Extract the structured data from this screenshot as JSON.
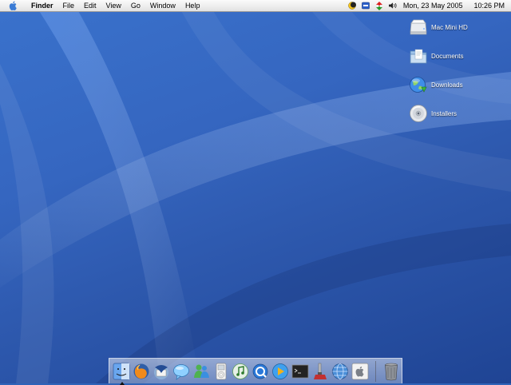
{
  "menubar": {
    "apple_menu_icon": "apple-icon",
    "app_name": "Finder",
    "menus": [
      "File",
      "Edit",
      "View",
      "Go",
      "Window",
      "Help"
    ],
    "status_icons": [
      "moon-icon",
      "display-icon",
      "network-icon",
      "volume-icon"
    ],
    "date": "Mon, 23 May 2005",
    "time": "10:26 PM"
  },
  "desktop": {
    "icons": [
      {
        "label": "Mac Mini HD",
        "icon": "hard-drive-icon"
      },
      {
        "label": "Documents",
        "icon": "folder-icon"
      },
      {
        "label": "Downloads",
        "icon": "globe-download-icon"
      },
      {
        "label": "Installers",
        "icon": "cd-icon"
      }
    ]
  },
  "dock": {
    "apps": [
      "finder-icon",
      "firefox-icon",
      "thunderbird-icon",
      "ichat-icon",
      "msn-messenger-icon",
      "ipod-icon",
      "itunes-icon",
      "quicktime-icon",
      "media-player-icon",
      "terminal-icon",
      "system-preferences-icon",
      "network-utility-icon",
      "apple-icon"
    ],
    "trash": "trash-icon"
  },
  "colors": {
    "desktop_blue": "#2f63b8",
    "menubar_bg": "#eeeeee"
  }
}
